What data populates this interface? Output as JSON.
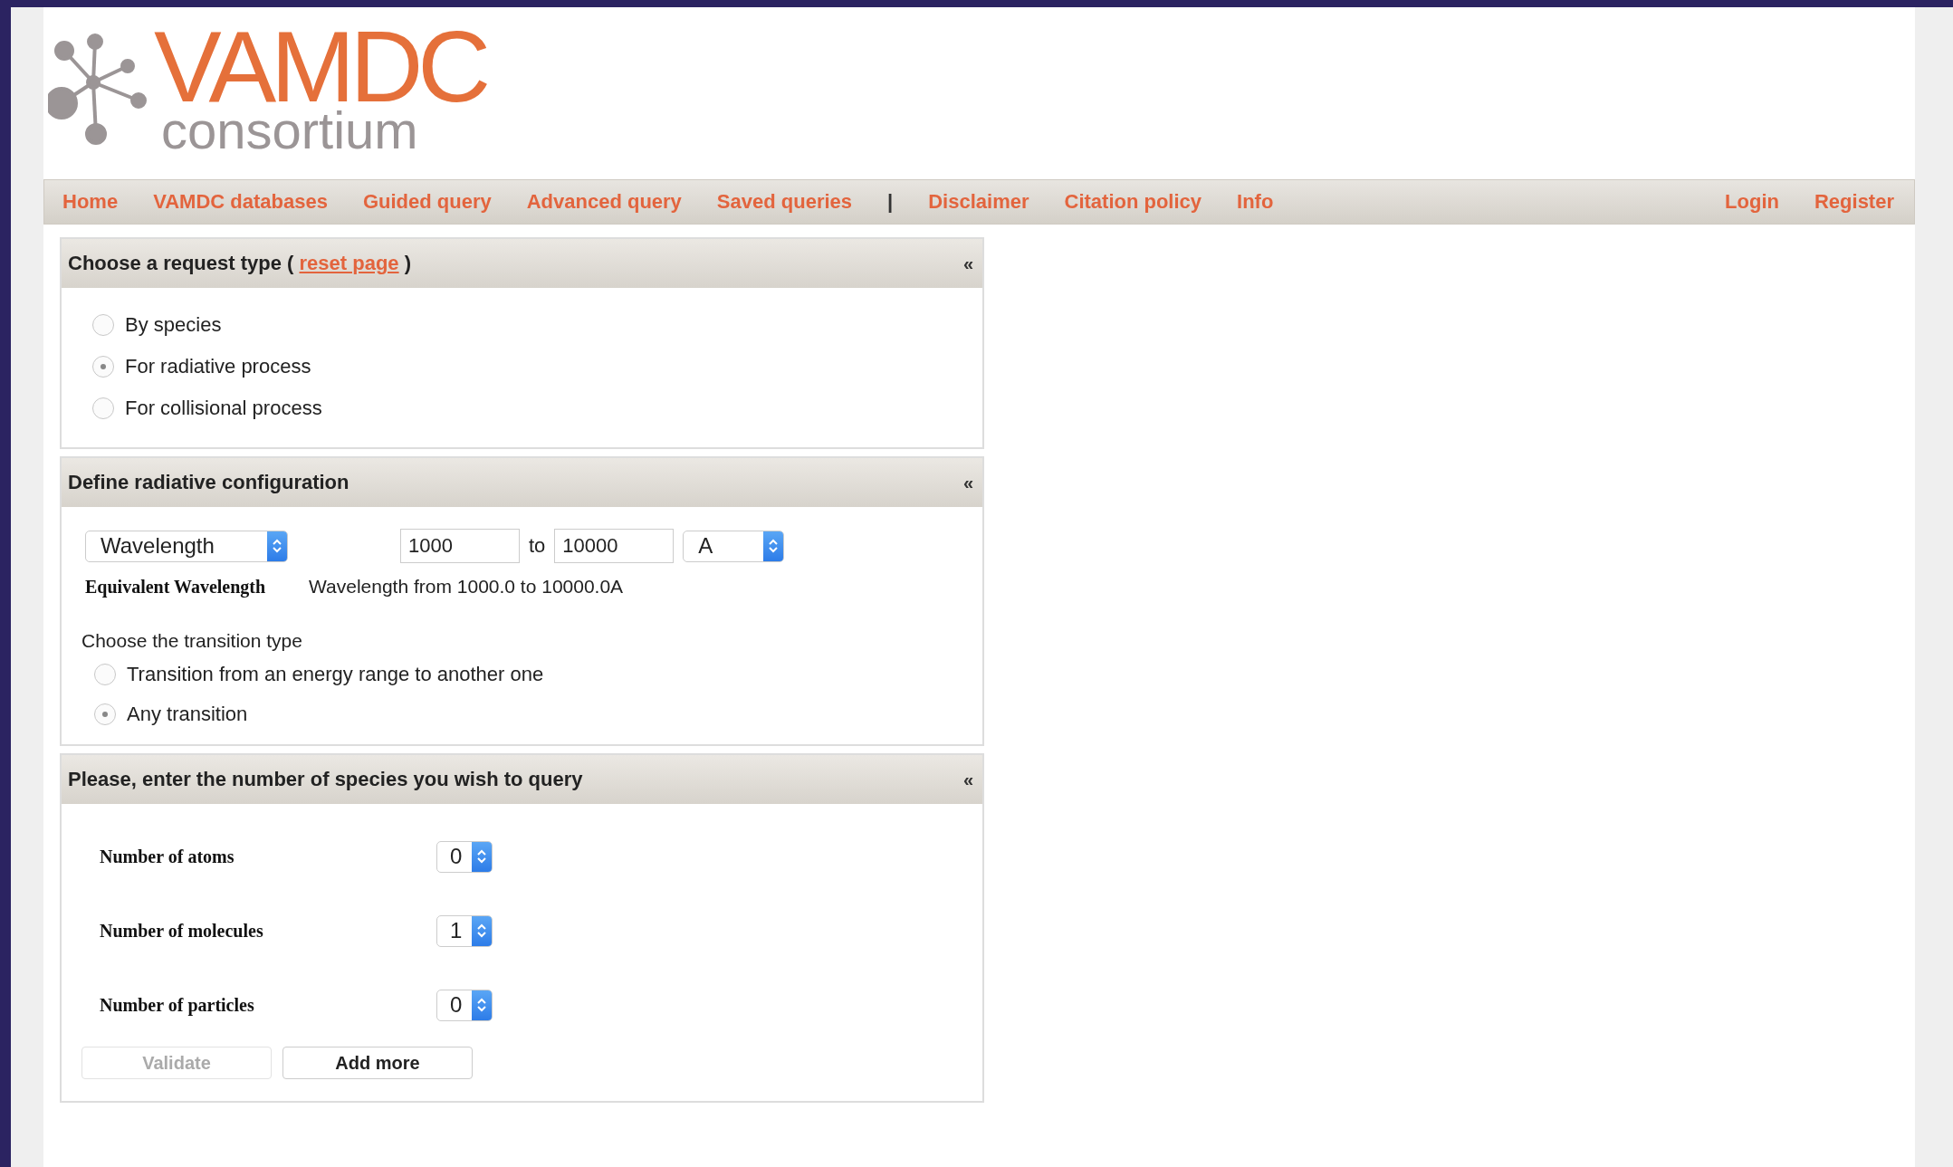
{
  "logo": {
    "title": "VAMDC",
    "subtitle": "consortium"
  },
  "nav": {
    "left": [
      {
        "kind": "link",
        "label": "Home"
      },
      {
        "kind": "link",
        "label": "VAMDC databases"
      },
      {
        "kind": "link",
        "label": "Guided query"
      },
      {
        "kind": "link",
        "label": "Advanced query"
      },
      {
        "kind": "link",
        "label": "Saved queries"
      },
      {
        "kind": "separator",
        "label": "|"
      },
      {
        "kind": "link",
        "label": "Disclaimer"
      },
      {
        "kind": "link",
        "label": "Citation policy"
      },
      {
        "kind": "link",
        "label": "Info"
      }
    ],
    "right": [
      "Login",
      "Register"
    ]
  },
  "request_type": {
    "title": "Choose a request type (",
    "link": "reset page",
    "title_end": ")",
    "collapse": "«",
    "options": [
      {
        "label": "By species",
        "selected": false
      },
      {
        "label": "For radiative process",
        "selected": true
      },
      {
        "label": "For collisional process",
        "selected": false
      }
    ]
  },
  "radiative_config": {
    "title": "Define radiative configuration",
    "collapse": "«",
    "quantity": "Wavelength",
    "from": "1000",
    "to_label": "to",
    "to": "10000",
    "unit": "A",
    "equivalent_label": "Equivalent Wavelength",
    "equivalent": "Wavelength from 1000.0 to 10000.0A",
    "transition_label": "Choose the transition type",
    "transitions": [
      {
        "label": "Transition from an energy range to another one",
        "selected": false
      },
      {
        "label": "Any transition",
        "selected": true
      }
    ]
  },
  "species_count": {
    "title": "Please, enter the number of species you wish to query",
    "collapse": "«",
    "rows": [
      {
        "label": "Number of atoms",
        "value": "0"
      },
      {
        "label": "Number of molecules",
        "value": "1"
      },
      {
        "label": "Number of particles",
        "value": "0"
      }
    ],
    "buttons": [
      {
        "label": "Validate",
        "disabled": true
      },
      {
        "label": "Add more",
        "disabled": false
      }
    ]
  }
}
